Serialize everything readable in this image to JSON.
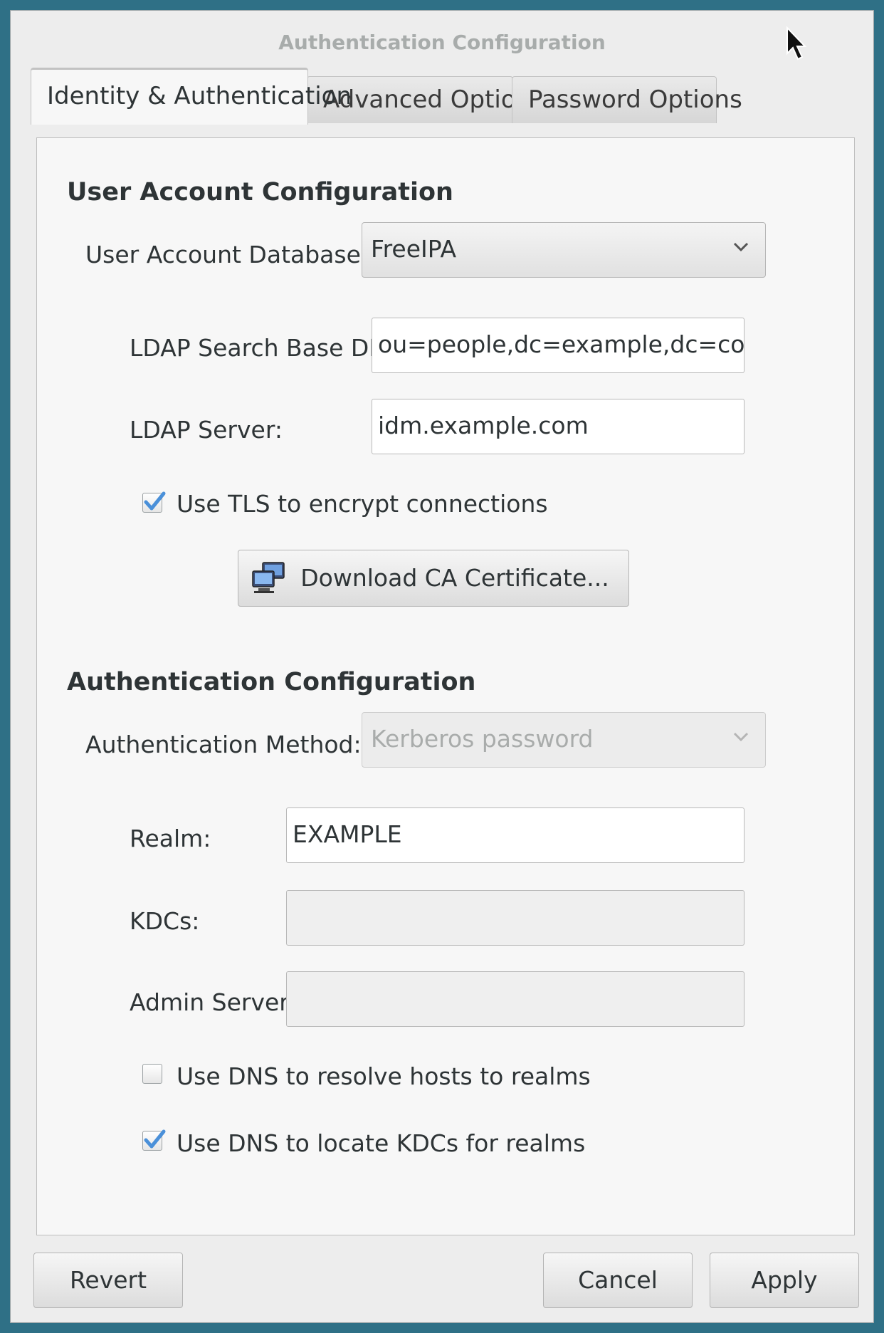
{
  "window": {
    "title": "Authentication Configuration"
  },
  "tabs": [
    {
      "label": "Identity & Authentication",
      "active": true
    },
    {
      "label": "Advanced Options",
      "active": false
    },
    {
      "label": "Password Options",
      "active": false
    }
  ],
  "user_account": {
    "section_title": "User Account Configuration",
    "database_label": "User Account Database:",
    "database_value": "FreeIPA",
    "ldap_base_dn_label": "LDAP Search Base DN:",
    "ldap_base_dn_value": "ou=people,dc=example,dc=co",
    "ldap_server_label": "LDAP Server:",
    "ldap_server_value": "idm.example.com",
    "use_tls_label": "Use TLS to encrypt connections",
    "use_tls_checked": true,
    "download_ca_label": "Download CA Certificate..."
  },
  "authentication": {
    "section_title": "Authentication Configuration",
    "method_label": "Authentication Method:",
    "method_value": "Kerberos password",
    "realm_label": "Realm:",
    "realm_value": "EXAMPLE",
    "kdcs_label": "KDCs:",
    "kdcs_value": "",
    "admin_servers_label": "Admin Servers:",
    "admin_servers_value": "",
    "dns_hosts_label": "Use DNS to resolve hosts to realms",
    "dns_hosts_checked": false,
    "dns_kdcs_label": "Use DNS to locate KDCs for realms",
    "dns_kdcs_checked": true
  },
  "buttons": {
    "revert": "Revert",
    "cancel": "Cancel",
    "apply": "Apply"
  },
  "colors": {
    "accent": "#4a90d9",
    "background": "#2f7086"
  }
}
